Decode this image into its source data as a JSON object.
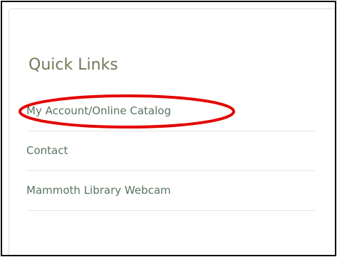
{
  "quick_links": {
    "title": "Quick Links",
    "items": [
      {
        "label": "My Account/Online Catalog"
      },
      {
        "label": "Contact"
      },
      {
        "label": "Mammoth Library Webcam"
      }
    ]
  },
  "colors": {
    "title_text": "#6e7b55",
    "link_text": "#58755f",
    "highlight": "#e30000",
    "frame": "#000000"
  }
}
